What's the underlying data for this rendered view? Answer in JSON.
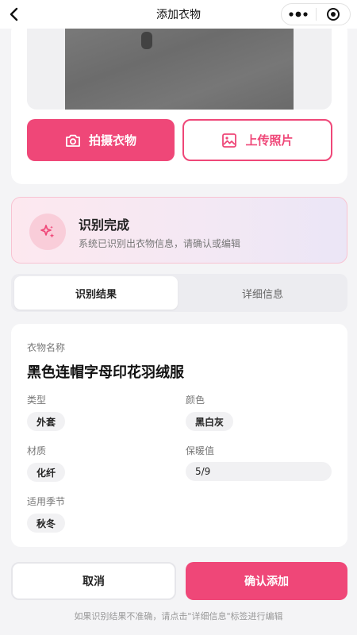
{
  "header": {
    "title": "添加衣物",
    "back_icon": "chevron-left-icon",
    "more_icon": "more-dots-icon",
    "close_icon": "target-close-icon"
  },
  "photo": {
    "camera_button": "拍摄衣物",
    "camera_icon": "camera-icon",
    "upload_button": "上传照片",
    "upload_icon": "image-icon"
  },
  "status": {
    "icon": "sparkle-icon",
    "title": "识别完成",
    "subtitle": "系统已识别出衣物信息，请确认或编辑"
  },
  "tabs": [
    {
      "label": "识别结果",
      "active": true
    },
    {
      "label": "详细信息",
      "active": false
    }
  ],
  "details": {
    "name_label": "衣物名称",
    "name_value": "黑色连帽字母印花羽绒服",
    "type_label": "类型",
    "type_value": "外套",
    "color_label": "颜色",
    "color_value": "黑白灰",
    "material_label": "材质",
    "material_value": "化纤",
    "warmth_label": "保暖值",
    "warmth_value": "5/9",
    "season_label": "适用季节",
    "season_value": "秋冬"
  },
  "actions": {
    "cancel": "取消",
    "confirm": "确认添加"
  },
  "tip": "如果识别结果不准确，请点击\"详细信息\"标签进行编辑",
  "colors": {
    "accent": "#ef4778",
    "status_border": "#f8c3d2",
    "status_bg_start": "#fde8ef",
    "status_bg_end": "#ebe6f6"
  }
}
